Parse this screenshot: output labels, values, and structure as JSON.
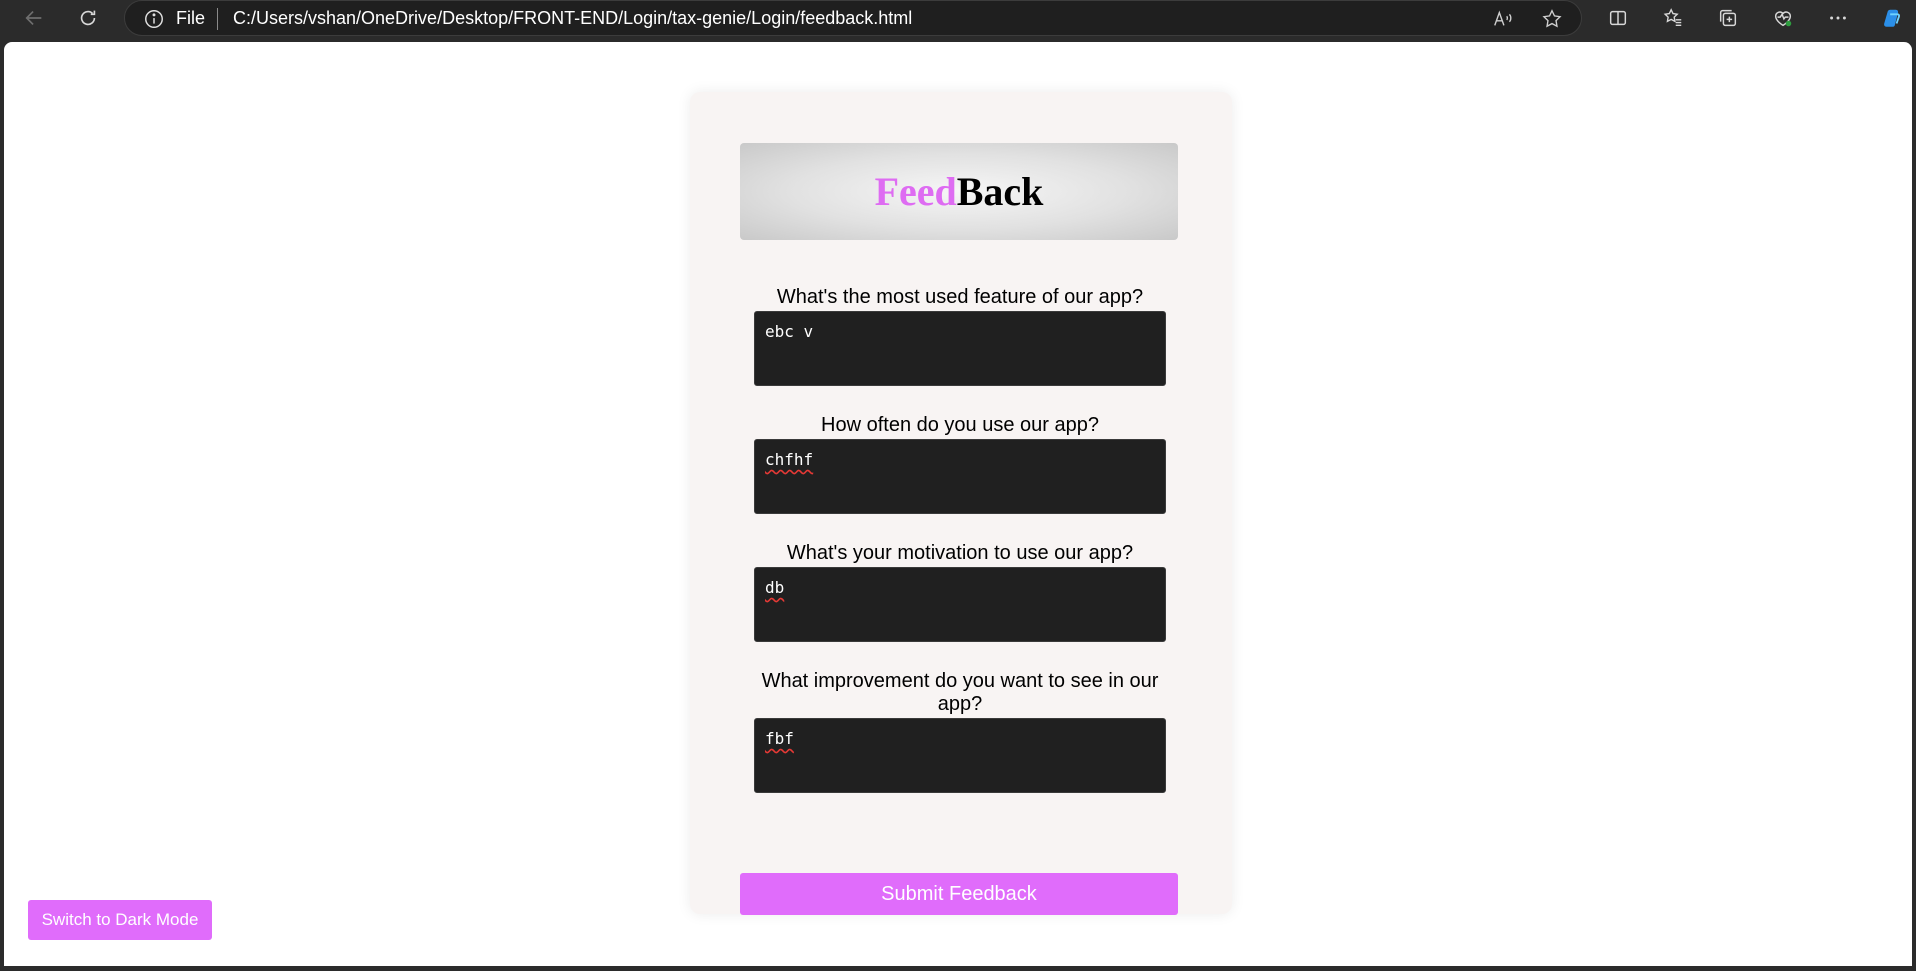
{
  "browser": {
    "address_scheme": "File",
    "address_url": "C:/Users/vshan/OneDrive/Desktop/FRONT-END/Login/tax-genie/Login/feedback.html"
  },
  "page": {
    "title_part1": "Feed",
    "title_part2": "Back",
    "questions": [
      {
        "label": "What's the most used feature of our app?",
        "answer": "ebc v"
      },
      {
        "label": "How often do you use our app?",
        "answer": "chfhf"
      },
      {
        "label": "What's your motivation to use our app?",
        "answer": "db"
      },
      {
        "label": "What improvement do you want to see in our app?",
        "answer": "fbf"
      }
    ],
    "submit_label": "Submit Feedback",
    "dark_mode_label": "Switch to Dark Mode"
  },
  "colors": {
    "accent": "#e06cfb",
    "title_accent": "#de6cf2",
    "textarea_bg": "#202020",
    "card_bg": "#f8f4f3"
  },
  "icons": {
    "toolbar": [
      "back-arrow-icon",
      "refresh-icon",
      "info-icon",
      "read-aloud-icon",
      "favorite-star-icon",
      "split-screen-icon",
      "favorites-icon",
      "collections-icon",
      "browser-essentials-icon",
      "more-icon",
      "copilot-icon"
    ]
  }
}
